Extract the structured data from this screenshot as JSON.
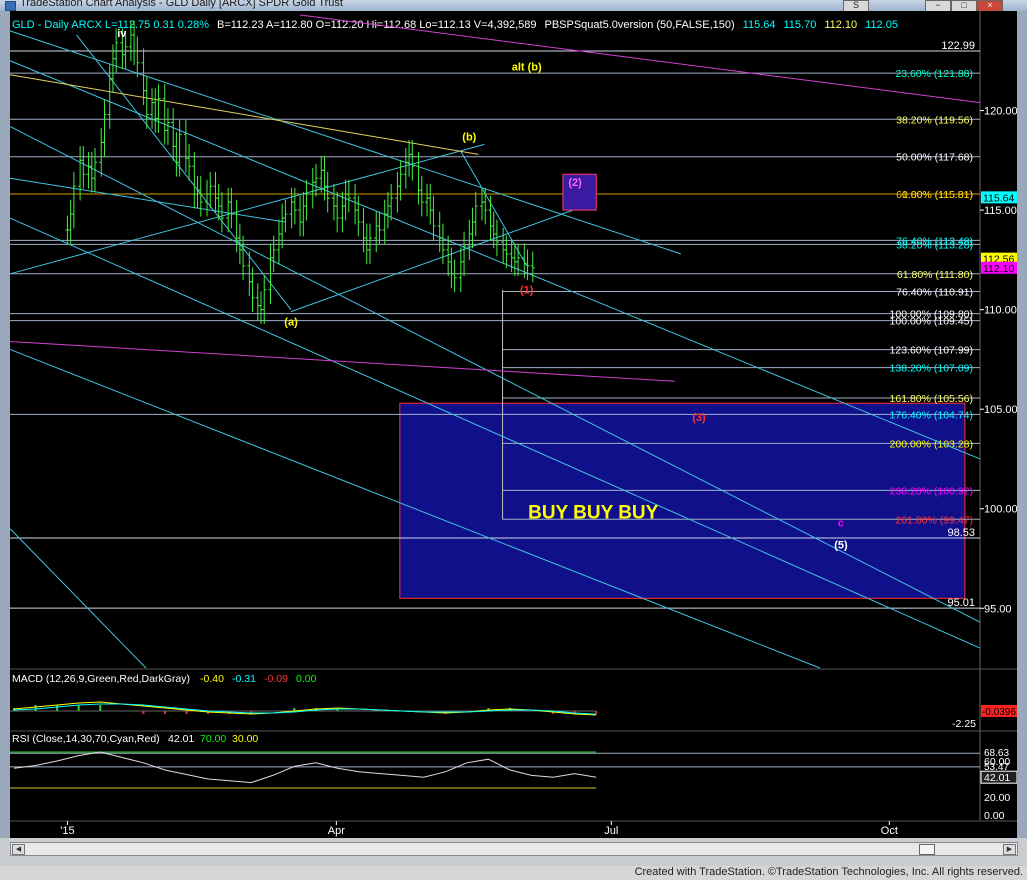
{
  "window": {
    "title": "TradeStation Chart Analysis - GLD Daily [ARCX] SPDR Gold Trust",
    "credit": "Created with TradeStation. ©TradeStation Technologies, Inc. All rights reserved.",
    "buttons": [
      "S",
      "−",
      "□",
      "×"
    ]
  },
  "header": {
    "items": [
      {
        "text": "GLD - Daily  ARCX  L=112.75  0.31  0.28%",
        "color": "#00ffff"
      },
      {
        "text": "B=112.23  A=112.80  O=112.20  Hi=112.68  Lo=112.13  V=4,392,589",
        "color": "#ffffff"
      },
      {
        "text": "PBSPSquat5.0version (50,FALSE,150)",
        "color": "#ffffff"
      },
      {
        "text": "115.64",
        "color": "#00ffff"
      },
      {
        "text": "115.70",
        "color": "#00ffff"
      },
      {
        "text": "112.10",
        "color": "#ffff66"
      },
      {
        "text": "112.05",
        "color": "#00ffff"
      }
    ]
  },
  "chart_data": [
    {
      "type": "bar",
      "title": "",
      "ylim": [
        92.0,
        125.0
      ],
      "price_ticks": [
        95.0,
        100.0,
        105.0,
        110.0,
        115.0,
        120.0
      ],
      "x_ticks": [
        {
          "label": "'15",
          "date": "2015-01-02"
        },
        {
          "label": "Apr",
          "date": "2015-04-01"
        },
        {
          "label": "Jul",
          "date": "2015-07-01"
        },
        {
          "label": "Oct",
          "date": "2015-10-01"
        }
      ],
      "last_price_labels": [
        {
          "value": 115.64,
          "text": "115.64",
          "color": "#00ffff"
        },
        {
          "value": 112.56,
          "text": "112.56",
          "color": "#ffff00"
        },
        {
          "value": 112.1,
          "text": "112.10",
          "color": "#ff00ff"
        }
      ],
      "ohlc_approx": {
        "start_date": "2015-01-02",
        "closes": [
          114.0,
          114.8,
          116.2,
          117.5,
          116.8,
          117.2,
          116.6,
          117.4,
          118.4,
          119.8,
          121.6,
          122.6,
          123.4,
          122.8,
          123.2,
          123.8,
          123.0,
          122.4,
          121.0,
          119.8,
          120.4,
          119.6,
          120.6,
          119.0,
          119.4,
          118.2,
          117.4,
          118.8,
          117.6,
          117.2,
          115.8,
          116.0,
          115.4,
          115.8,
          116.2,
          115.6,
          115.2,
          114.6,
          115.4,
          114.8,
          113.6,
          113.0,
          112.2,
          111.4,
          110.6,
          110.2,
          110.0,
          111.0,
          112.6,
          113.0,
          113.8,
          114.6,
          114.8,
          115.4,
          115.0,
          114.4,
          115.2,
          115.8,
          116.4,
          116.6,
          117.0,
          116.2,
          115.6,
          115.2,
          114.6,
          115.2,
          115.8,
          115.6,
          115.0,
          114.4,
          113.6,
          113.0,
          113.6,
          114.2,
          114.0,
          114.8,
          115.2,
          115.6,
          116.2,
          116.8,
          117.4,
          117.8,
          117.2,
          116.0,
          115.4,
          115.6,
          115.0,
          114.2,
          113.6,
          113.0,
          112.4,
          111.8,
          111.6,
          112.4,
          113.2,
          113.8,
          114.4,
          115.2,
          115.4,
          115.0,
          114.2,
          113.8,
          113.4,
          113.0,
          112.8,
          112.6,
          112.4,
          112.6,
          112.3,
          112.2,
          112.1
        ],
        "daily_range": 1.2
      },
      "fib_levels": [
        {
          "pct": "23.60%",
          "value": 121.88,
          "text": "23.60% (121.88)",
          "color": "#00ffcc"
        },
        {
          "pct": "38.20%",
          "value": 119.56,
          "text": "38.20% (119.56)",
          "color": "#ffff66"
        },
        {
          "pct": "50.00%",
          "value": 117.68,
          "text": "50.00% (117.68)",
          "color": "#ffffff"
        },
        {
          "pct": "61.80%",
          "value": 115.81,
          "text": "61.80% (115.81)",
          "color": "#ffcc00"
        },
        {
          "pct": "0.00%",
          "value": 115.81,
          "text": "0.00% (115.81)",
          "color": "#ffcc00"
        },
        {
          "pct": "76.40%",
          "value": 113.48,
          "text": "76.40% (113.48)",
          "color": "#00ffff"
        },
        {
          "pct": "38.20%",
          "value": 113.28,
          "text": "38.20% (113.28)",
          "color": "#00ffff"
        },
        {
          "pct": "61.80%",
          "value": 111.8,
          "text": "61.80% (111.80)",
          "color": "#ffff66"
        },
        {
          "pct": "76.40%",
          "value": 110.91,
          "text": "76.40% (110.91)",
          "color": "#ffffff"
        },
        {
          "pct": "100.00%",
          "value": 109.8,
          "text": "100.00% (109.80)",
          "color": "#ffffff"
        },
        {
          "pct": "100.00%",
          "value": 109.45,
          "text": "100.00% (109.45)",
          "color": "#ffffff"
        },
        {
          "pct": "123.60%",
          "value": 107.99,
          "text": "123.60% (107.99)",
          "color": "#ffffff"
        },
        {
          "pct": "138.20%",
          "value": 107.09,
          "text": "138.20% (107.09)",
          "color": "#00ffff"
        },
        {
          "pct": "161.80%",
          "value": 105.56,
          "text": "161.80% (105.56)",
          "color": "#ffff66"
        },
        {
          "pct": "176.40%",
          "value": 104.74,
          "text": "176.40% (104.74)",
          "color": "#00ffff"
        },
        {
          "pct": "200.00%",
          "value": 103.28,
          "text": "200.00% (103.28)",
          "color": "#ffff00"
        },
        {
          "pct": "238.20%",
          "value": 100.92,
          "text": "238.20% (100.92)",
          "color": "#ff00ff"
        },
        {
          "pct": "261.80%",
          "value": 99.47,
          "text": "261.80% (99.47)",
          "color": "#ff3333"
        }
      ],
      "horizontal_levels": [
        {
          "value": 122.99,
          "text": "122.99"
        },
        {
          "value": 98.53,
          "text": "98.53"
        },
        {
          "value": 95.01,
          "text": "95.01"
        }
      ],
      "wave_labels": [
        {
          "text": "iv",
          "date": "2015-01-20",
          "value": 123.7,
          "color": "#ffffff"
        },
        {
          "text": "alt (b)",
          "date": "2015-06-03",
          "value": 122.0,
          "color": "#ffff00"
        },
        {
          "text": "(b)",
          "date": "2015-05-15",
          "value": 118.5,
          "color": "#ffff00"
        },
        {
          "text": "(2)",
          "date": "2015-06-19",
          "value": 116.2,
          "color": "#ff66ff"
        },
        {
          "text": "(1)",
          "date": "2015-06-03",
          "value": 110.8,
          "color": "#ff3333"
        },
        {
          "text": "(a)",
          "date": "2015-03-17",
          "value": 109.2,
          "color": "#ffff00"
        },
        {
          "text": "(3)",
          "date": "2015-07-30",
          "value": 104.4,
          "color": "#ff3333"
        },
        {
          "text": "c",
          "date": "2015-09-15",
          "value": 99.1,
          "color": "#ff00ff"
        },
        {
          "text": "(5)",
          "date": "2015-09-15",
          "value": 98.0,
          "color": "#ffffff"
        }
      ],
      "annotations": [
        {
          "text": "BUY BUY BUY",
          "color": "#ffff00"
        }
      ]
    },
    {
      "type": "line",
      "title": "MACD (12,26,9,Green,Red,DarkGray)",
      "values_text": [
        {
          "text": "-0.40",
          "color": "#ffff00"
        },
        {
          "text": "-0.31",
          "color": "#00ffff"
        },
        {
          "text": "-0.09",
          "color": "#ff3333"
        },
        {
          "text": "0.00",
          "color": "#00ff00"
        }
      ],
      "axis_labels": [
        "-2.25"
      ],
      "last_value": {
        "text": "-0.0396",
        "color": "#ff3333"
      },
      "series": [
        {
          "name": "MACD",
          "values": [
            0.2,
            0.4,
            0.6,
            0.8,
            0.9,
            0.7,
            0.5,
            0.3,
            0.1,
            -0.1,
            -0.2,
            -0.3,
            -0.2,
            0.0,
            0.2,
            0.3,
            0.2,
            0.1,
            0.0,
            -0.1,
            -0.2,
            -0.1,
            0.1,
            0.2,
            0.1,
            -0.1,
            -0.3,
            -0.4
          ]
        },
        {
          "name": "Signal",
          "values": [
            0.1,
            0.2,
            0.4,
            0.6,
            0.7,
            0.7,
            0.6,
            0.4,
            0.2,
            0.0,
            -0.1,
            -0.2,
            -0.2,
            -0.1,
            0.1,
            0.2,
            0.2,
            0.1,
            0.0,
            -0.1,
            -0.1,
            -0.1,
            0.0,
            0.1,
            0.1,
            0.0,
            -0.2,
            -0.31
          ]
        }
      ]
    },
    {
      "type": "line",
      "title": "RSI (Close,14,30,70,Cyan,Red)",
      "values_text": [
        {
          "text": "42.01",
          "color": "#ffffff"
        },
        {
          "text": "70.00",
          "color": "#00ff00"
        },
        {
          "text": "30.00",
          "color": "#ffff00"
        }
      ],
      "axis_labels": [
        "60.00",
        "20.00",
        "0.00"
      ],
      "extra_labels": [
        "68.63",
        "53.47"
      ],
      "last_value": {
        "text": "42.01",
        "color": "#ffffff"
      },
      "series": [
        {
          "name": "RSI",
          "values": [
            52,
            55,
            60,
            66,
            70,
            64,
            58,
            50,
            45,
            40,
            38,
            36,
            44,
            54,
            58,
            52,
            48,
            46,
            44,
            42,
            48,
            58,
            62,
            50,
            44,
            42,
            46,
            42
          ]
        }
      ]
    }
  ]
}
